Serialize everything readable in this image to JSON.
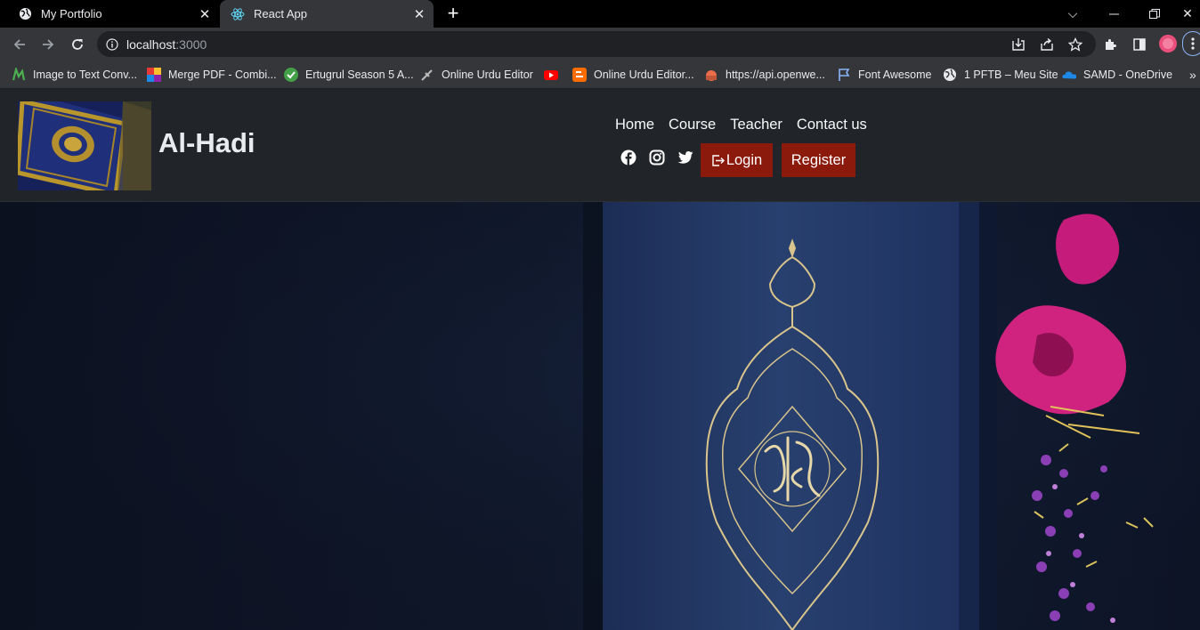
{
  "browser": {
    "tabs": [
      {
        "title": "My Portfolio",
        "icon": "globe-icon",
        "active": false
      },
      {
        "title": "React App",
        "icon": "react-icon",
        "active": true
      }
    ],
    "address": {
      "host": "localhost",
      "port": ":3000"
    },
    "bookmarks": [
      {
        "label": "Image to Text Conv...",
        "icon": "image-to-text-icon"
      },
      {
        "label": "Merge PDF - Combi...",
        "icon": "merge-pdf-icon"
      },
      {
        "label": "Ertugrul Season 5 A...",
        "icon": "check-circle-icon"
      },
      {
        "label": "Online Urdu Editor",
        "icon": "quill-icon"
      },
      {
        "label": "",
        "icon": "youtube-icon"
      },
      {
        "label": "Online Urdu Editor...",
        "icon": "blogger-icon"
      },
      {
        "label": "https://api.openwe...",
        "icon": "openweather-icon"
      },
      {
        "label": "Font Awesome",
        "icon": "flag-icon"
      },
      {
        "label": "1 PFTB – Meu Site",
        "icon": "wordpress-icon"
      },
      {
        "label": "SAMD - OneDrive",
        "icon": "onedrive-icon"
      }
    ],
    "overflow_label": "»"
  },
  "site": {
    "brand": "Al-Hadi",
    "nav": [
      "Home",
      "Course",
      "Teacher",
      "Contact us"
    ],
    "social_icons": [
      "facebook-icon",
      "instagram-icon",
      "twitter-icon"
    ],
    "login_label": "Login",
    "register_label": "Register"
  },
  "colors": {
    "header_bg": "#212529",
    "button_bg": "#8b1a0c",
    "hero_bg": "#0f1729"
  }
}
